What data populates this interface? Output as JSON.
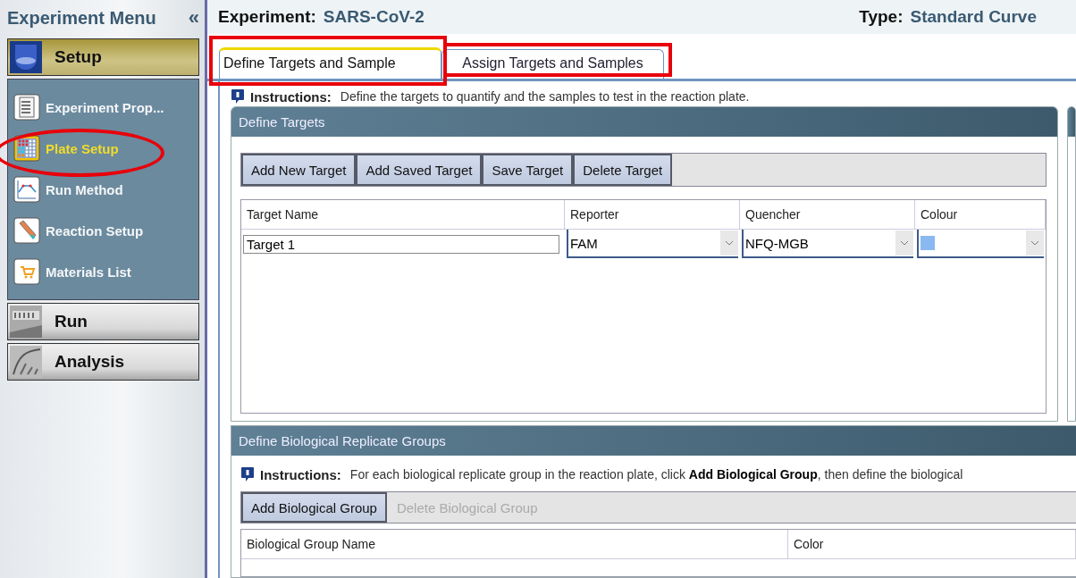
{
  "sidebar": {
    "title": "Experiment Menu",
    "collapse_glyph": "«",
    "sections": [
      {
        "label": "Setup",
        "kind": "setup",
        "items": [
          {
            "label": "Experiment Prop...",
            "selected": false
          },
          {
            "label": "Plate Setup",
            "selected": true
          },
          {
            "label": "Run Method",
            "selected": false
          },
          {
            "label": "Reaction Setup",
            "selected": false
          },
          {
            "label": "Materials List",
            "selected": false
          }
        ]
      },
      {
        "label": "Run",
        "kind": "run"
      },
      {
        "label": "Analysis",
        "kind": "analysis"
      }
    ]
  },
  "header": {
    "experiment_label": "Experiment:",
    "experiment_name": "SARS-CoV-2",
    "type_label": "Type:",
    "type_value": "Standard Curve"
  },
  "tabs": [
    {
      "label": "Define Targets and Sample",
      "selected": true
    },
    {
      "label": "Assign Targets and Samples",
      "selected": false
    }
  ],
  "instructions": {
    "label": "Instructions:",
    "text": "Define the targets to quantify and the samples to test in the reaction plate."
  },
  "define_targets": {
    "title": "Define Targets",
    "buttons": [
      {
        "label": "Add New Target",
        "disabled": false
      },
      {
        "label": "Add Saved Target",
        "disabled": false
      },
      {
        "label": "Save Target",
        "disabled": false
      },
      {
        "label": "Delete Target",
        "disabled": false
      }
    ],
    "table": {
      "columns": [
        "Target Name",
        "Reporter",
        "Quencher",
        "Colour"
      ],
      "rows": [
        {
          "target_name": "Target 1",
          "reporter": "FAM",
          "quencher": "NFQ-MGB",
          "color": "#8ab8f0"
        }
      ]
    }
  },
  "biological_groups": {
    "title": "Define Biological Replicate Groups",
    "instructions": {
      "label": "Instructions:",
      "text": "For each biological replicate group in the reaction plate, click **Add Biological Group**, then define the biological"
    },
    "buttons": [
      {
        "label": "Add Biological Group",
        "disabled": false
      },
      {
        "label": "Delete Biological Group",
        "disabled": true
      }
    ],
    "table": {
      "columns": [
        "Biological Group Name",
        "Color"
      ]
    }
  }
}
